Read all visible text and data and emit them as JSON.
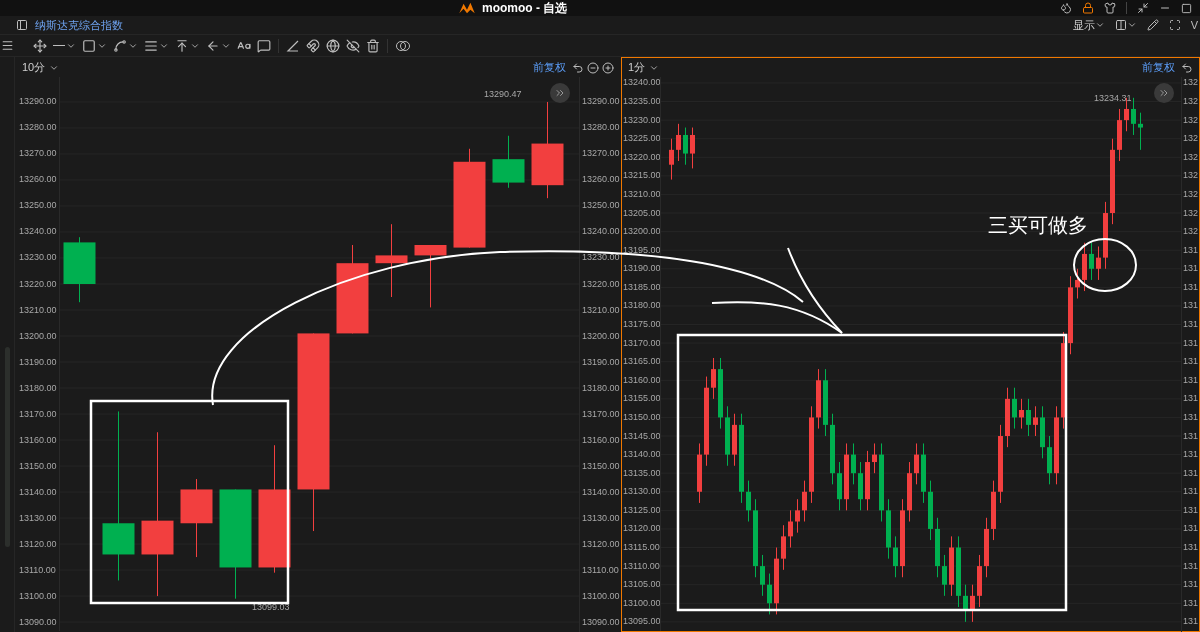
{
  "window": {
    "title": "moomoo - 自选"
  },
  "header": {
    "symbol": "纳斯达克综合指数",
    "display_menu": "显示",
    "cut_letter": "V"
  },
  "panes": [
    {
      "interval": "10分",
      "adjust": "前复权",
      "selected": false,
      "high_label": "13290.47",
      "low_label": "13099.03",
      "chart_data": {
        "type": "candlestick",
        "grid": true,
        "categories": [
          null,
          null,
          null,
          null,
          null,
          null,
          null,
          null,
          null,
          null,
          null,
          null,
          null
        ],
        "ylim": [
          13085.8,
          13299.6
        ],
        "yticks": [
          {
            "value": 13290,
            "label": "13290.00"
          },
          {
            "value": 13280,
            "label": "13280.00"
          },
          {
            "value": 13270,
            "label": "13270.00"
          },
          {
            "value": 13260,
            "label": "13260.00"
          },
          {
            "value": 13250,
            "label": "13250.00"
          },
          {
            "value": 13240,
            "label": "13240.00"
          },
          {
            "value": 13230,
            "label": "13230.00"
          },
          {
            "value": 13220,
            "label": "13220.00"
          },
          {
            "value": 13210,
            "label": "13210.00"
          },
          {
            "value": 13200,
            "label": "13200.00"
          },
          {
            "value": 13190,
            "label": "13190.00"
          },
          {
            "value": 13180,
            "label": "13180.00"
          },
          {
            "value": 13170,
            "label": "13170.00"
          },
          {
            "value": 13160,
            "label": "13160.00"
          },
          {
            "value": 13150,
            "label": "13150.00"
          },
          {
            "value": 13140,
            "label": "13140.00"
          },
          {
            "value": 13130,
            "label": "13130.00"
          },
          {
            "value": 13120,
            "label": "13120.00"
          },
          {
            "value": 13110,
            "label": "13110.00"
          },
          {
            "value": 13100,
            "label": "13100.00"
          },
          {
            "value": 13090,
            "label": "13090.00"
          }
        ],
        "ohlc": [
          [
            13236,
            13238,
            13213,
            13220
          ],
          [
            13128,
            13171,
            13106,
            13116
          ],
          [
            13116,
            13163,
            13100,
            13129
          ],
          [
            13128,
            13145,
            13115,
            13141
          ],
          [
            13141,
            13141,
            13099,
            13111
          ],
          [
            13111,
            13158,
            13109,
            13141
          ],
          [
            13141,
            13201,
            13125,
            13201
          ],
          [
            13201,
            13235,
            13201,
            13228
          ],
          [
            13228,
            13243,
            13215,
            13231
          ],
          [
            13231,
            13235,
            13211,
            13235
          ],
          [
            13234,
            13272,
            13234,
            13267
          ],
          [
            13268,
            13277,
            13257,
            13259
          ],
          [
            13258,
            13290,
            13253,
            13274
          ]
        ]
      },
      "right_axis": [
        "13290.00",
        "13280.00",
        "13270.00",
        "13260.00",
        "13250.00",
        "13240.00",
        "13230.00",
        "13220.00",
        "13210.00",
        "13200.00",
        "13190.00",
        "13180.00",
        "13170.00",
        "13160.00",
        "13150.00",
        "13140.00",
        "13130.00",
        "13120.00",
        "13110.00",
        "13100.00",
        "13090.00"
      ]
    },
    {
      "interval": "1分",
      "adjust": "前复权",
      "selected": true,
      "high_label": "13234.31",
      "chart_data": {
        "type": "candlestick",
        "categories": [
          null,
          null,
          null,
          null,
          null,
          null,
          null,
          null,
          null,
          null,
          null,
          null,
          null,
          null,
          null,
          null,
          null,
          null,
          null,
          null,
          null,
          null,
          null,
          null,
          null,
          null,
          null,
          null,
          null,
          null,
          null,
          null,
          null,
          null,
          null,
          null,
          null,
          null,
          null,
          null,
          null,
          null,
          null,
          null,
          null,
          null,
          null,
          null,
          null,
          null,
          null,
          null,
          null,
          null,
          null,
          null,
          null,
          null,
          null,
          null,
          null,
          null,
          null,
          null,
          null,
          null,
          null,
          null
        ],
        "grid": true,
        "ylim": [
          13092.0,
          13241.6
        ],
        "yticks": [
          {
            "value": 13240,
            "label": "13240.00"
          },
          {
            "value": 13235,
            "label": "13235.00"
          },
          {
            "value": 13230,
            "label": "13230.00"
          },
          {
            "value": 13225,
            "label": "13225.00"
          },
          {
            "value": 13220,
            "label": "13220.00"
          },
          {
            "value": 13215,
            "label": "13215.00"
          },
          {
            "value": 13210,
            "label": "13210.00"
          },
          {
            "value": 13205,
            "label": "13205.00"
          },
          {
            "value": 13200,
            "label": "13200.00"
          },
          {
            "value": 13195,
            "label": "13195.00"
          },
          {
            "value": 13190,
            "label": "13190.00"
          },
          {
            "value": 13185,
            "label": "13185.00"
          },
          {
            "value": 13180,
            "label": "13180.00"
          },
          {
            "value": 13175,
            "label": "13175.00"
          },
          {
            "value": 13170,
            "label": "13170.00"
          },
          {
            "value": 13165,
            "label": "13165.00"
          },
          {
            "value": 13160,
            "label": "13160.00"
          },
          {
            "value": 13155,
            "label": "13155.00"
          },
          {
            "value": 13150,
            "label": "13150.00"
          },
          {
            "value": 13145,
            "label": "13145.00"
          },
          {
            "value": 13140,
            "label": "13140.00"
          },
          {
            "value": 13135,
            "label": "13135.00"
          },
          {
            "value": 13130,
            "label": "13130.00"
          },
          {
            "value": 13125,
            "label": "13125.00"
          },
          {
            "value": 13120,
            "label": "13120.00"
          },
          {
            "value": 13115,
            "label": "13115.00"
          },
          {
            "value": 13110,
            "label": "13110.00"
          },
          {
            "value": 13105,
            "label": "13105.00"
          },
          {
            "value": 13100,
            "label": "13100.00"
          },
          {
            "value": 13095,
            "label": "13095.00"
          }
        ],
        "ohlc": [
          [
            13218,
            13225,
            13214,
            13222
          ],
          [
            13222,
            13229,
            13219,
            13226
          ],
          [
            13226,
            13228,
            13218,
            13221
          ],
          [
            13221,
            13228,
            13217,
            13226
          ],
          [
            13130,
            13143,
            13127,
            13140
          ],
          [
            13140,
            13161,
            13137,
            13158
          ],
          [
            13158,
            13166,
            13155,
            13163
          ],
          [
            13163,
            13166,
            13147,
            13150
          ],
          [
            13150,
            13153,
            13137,
            13140
          ],
          [
            13140,
            13151,
            13137,
            13148
          ],
          [
            13148,
            13151,
            13127,
            13130
          ],
          [
            13130,
            13133,
            13122,
            13125
          ],
          [
            13125,
            13128,
            13107,
            13110
          ],
          [
            13110,
            13113,
            13102,
            13105
          ],
          [
            13105,
            13108,
            13097,
            13100
          ],
          [
            13100,
            13115,
            13097,
            13112
          ],
          [
            13112,
            13121,
            13109,
            13118
          ],
          [
            13118,
            13125,
            13115,
            13122
          ],
          [
            13122,
            13128,
            13119,
            13125
          ],
          [
            13125,
            13133,
            13122,
            13130
          ],
          [
            13130,
            13153,
            13127,
            13150
          ],
          [
            13150,
            13163,
            13147,
            13160
          ],
          [
            13160,
            13163,
            13145,
            13148
          ],
          [
            13148,
            13151,
            13132,
            13135
          ],
          [
            13135,
            13138,
            13125,
            13128
          ],
          [
            13128,
            13143,
            13125,
            13140
          ],
          [
            13140,
            13143,
            13132,
            13135
          ],
          [
            13135,
            13138,
            13125,
            13128
          ],
          [
            13128,
            13141,
            13125,
            13138
          ],
          [
            13138,
            13143,
            13135,
            13140
          ],
          [
            13140,
            13143,
            13122,
            13125
          ],
          [
            13125,
            13128,
            13112,
            13115
          ],
          [
            13115,
            13118,
            13107,
            13110
          ],
          [
            13110,
            13128,
            13107,
            13125
          ],
          [
            13125,
            13138,
            13122,
            13135
          ],
          [
            13135,
            13143,
            13132,
            13140
          ],
          [
            13140,
            13143,
            13127,
            13130
          ],
          [
            13130,
            13133,
            13117,
            13120
          ],
          [
            13120,
            13123,
            13107,
            13110
          ],
          [
            13110,
            13113,
            13102,
            13105
          ],
          [
            13105,
            13118,
            13102,
            13115
          ],
          [
            13115,
            13118,
            13099,
            13102
          ],
          [
            13102,
            13105,
            13095,
            13098
          ],
          [
            13098,
            13105,
            13095,
            13102
          ],
          [
            13102,
            13113,
            13099,
            13110
          ],
          [
            13110,
            13123,
            13107,
            13120
          ],
          [
            13120,
            13133,
            13117,
            13130
          ],
          [
            13130,
            13148,
            13127,
            13145
          ],
          [
            13145,
            13158,
            13142,
            13155
          ],
          [
            13155,
            13158,
            13147,
            13150
          ],
          [
            13150,
            13155,
            13147,
            13152
          ],
          [
            13152,
            13155,
            13145,
            13148
          ],
          [
            13148,
            13153,
            13145,
            13150
          ],
          [
            13150,
            13153,
            13139,
            13142
          ],
          [
            13142,
            13145,
            13132,
            13135
          ],
          [
            13135,
            13153,
            13132,
            13150
          ],
          [
            13150,
            13173,
            13147,
            13170
          ],
          [
            13170,
            13188,
            13167,
            13185
          ],
          [
            13185,
            13190,
            13182,
            13187
          ],
          [
            13187,
            13197,
            13184,
            13194
          ],
          [
            13194,
            13197,
            13187,
            13190
          ],
          [
            13190,
            13196,
            13187,
            13193
          ],
          [
            13193,
            13208,
            13190,
            13205
          ],
          [
            13205,
            13225,
            13202,
            13222
          ],
          [
            13222,
            13233,
            13219,
            13230
          ],
          [
            13230,
            13236,
            13227,
            13233
          ],
          [
            13233,
            13236,
            13226,
            13229
          ],
          [
            13229,
            13232,
            13222,
            13228
          ]
        ]
      },
      "right_axis": [
        "132",
        "132",
        "132",
        "132",
        "132",
        "132",
        "132",
        "132",
        "132",
        "131",
        "131",
        "131",
        "131",
        "131",
        "131",
        "131",
        "131",
        "131",
        "131",
        "131",
        "131",
        "131",
        "131",
        "131",
        "131",
        "131",
        "131",
        "131",
        "131",
        "131"
      ]
    }
  ],
  "annotation": {
    "text": "三买可做多"
  }
}
